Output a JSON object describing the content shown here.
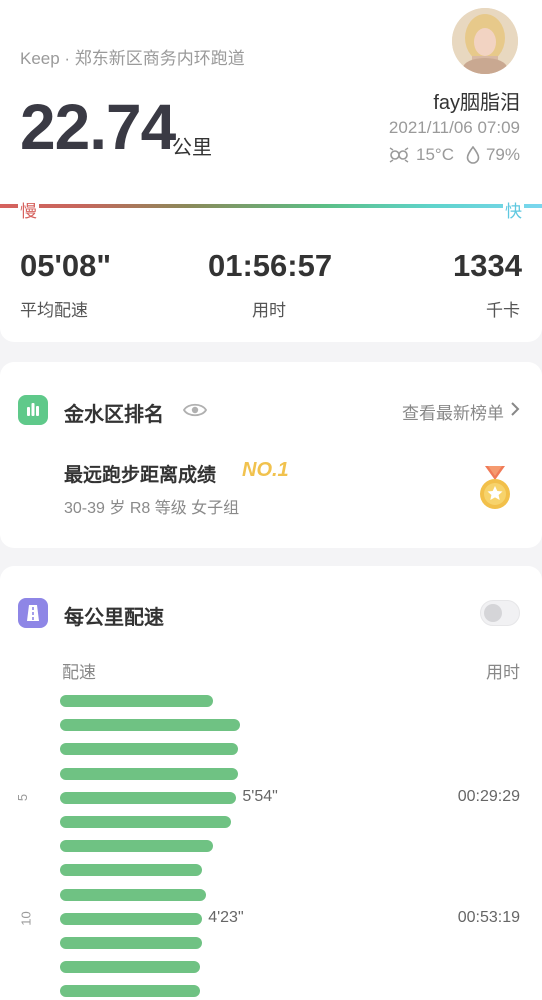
{
  "header": {
    "source": "Keep · 郑东新区商务内环跑道",
    "username": "fay胭脂泪",
    "datetime": "2021/11/06 07:09",
    "temperature": "15°C",
    "humidity": "79%"
  },
  "distance": {
    "value": "22.74",
    "unit": "公里"
  },
  "pace_scale": {
    "slow": "慢",
    "fast": "快"
  },
  "stats": [
    {
      "value": "05'08\"",
      "label": "平均配速"
    },
    {
      "value": "01:56:57",
      "label": "用时"
    },
    {
      "value": "1334",
      "label": "千卡"
    }
  ],
  "ranking": {
    "title": "金水区排名",
    "link": "查看最新榜单",
    "achievement": "最远跑步距离成绩",
    "rank": "NO.1",
    "subtitle": "30-39 岁 R8 等级 女子组",
    "icon_color": "#5fc98a"
  },
  "splits": {
    "title": "每公里配速",
    "icon_color": "#8e86e6",
    "col_pace": "配速",
    "col_time": "用时",
    "bar_color": "#6fc283",
    "km_marks": [
      {
        "km": "5"
      },
      {
        "km": "10"
      }
    ],
    "bars": [
      {
        "rel": 0.85,
        "pace": "",
        "time": ""
      },
      {
        "rel": 1.0,
        "pace": "",
        "time": ""
      },
      {
        "rel": 0.99,
        "pace": "",
        "time": ""
      },
      {
        "rel": 0.99,
        "pace": "",
        "time": ""
      },
      {
        "rel": 0.98,
        "pace": "5'54\"",
        "time": "00:29:29"
      },
      {
        "rel": 0.95,
        "pace": "",
        "time": ""
      },
      {
        "rel": 0.85,
        "pace": "",
        "time": ""
      },
      {
        "rel": 0.79,
        "pace": "",
        "time": ""
      },
      {
        "rel": 0.81,
        "pace": "",
        "time": ""
      },
      {
        "rel": 0.79,
        "pace": "4'23\"",
        "time": "00:53:19"
      },
      {
        "rel": 0.79,
        "pace": "",
        "time": ""
      },
      {
        "rel": 0.78,
        "pace": "",
        "time": ""
      },
      {
        "rel": 0.78,
        "pace": "",
        "time": ""
      }
    ]
  }
}
